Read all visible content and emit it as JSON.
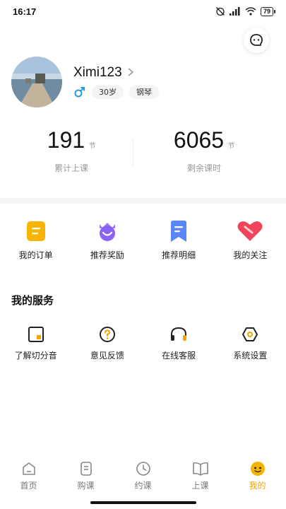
{
  "status_bar": {
    "time": "16:17",
    "battery": "79"
  },
  "profile": {
    "name": "Ximi123",
    "age": "30岁",
    "instrument": "钢琴"
  },
  "stats": [
    {
      "value": "191",
      "unit": "节",
      "label": "累计上课"
    },
    {
      "value": "6065",
      "unit": "节",
      "label": "剩余课时"
    }
  ],
  "quick_actions": [
    {
      "label": "我的订单",
      "icon": "order-icon"
    },
    {
      "label": "推荐奖励",
      "icon": "reward-icon"
    },
    {
      "label": "推荐明细",
      "icon": "bookmark-icon"
    },
    {
      "label": "我的关注",
      "icon": "heart-icon"
    }
  ],
  "services": {
    "title": "我的服务",
    "items": [
      {
        "label": "了解切分音",
        "icon": "about-icon"
      },
      {
        "label": "意见反馈",
        "icon": "feedback-icon"
      },
      {
        "label": "在线客服",
        "icon": "headset-icon"
      },
      {
        "label": "系统设置",
        "icon": "settings-icon"
      }
    ]
  },
  "tabs": [
    {
      "label": "首页",
      "icon": "home-icon"
    },
    {
      "label": "购课",
      "icon": "purchase-icon"
    },
    {
      "label": "约课",
      "icon": "clock-icon"
    },
    {
      "label": "上课",
      "icon": "book-icon"
    },
    {
      "label": "我的",
      "icon": "profile-face-icon",
      "active": true
    }
  ],
  "colors": {
    "accent": "#f5a300",
    "gender": "#1e9be8",
    "reward": "#8a63f5",
    "bookmark": "#5b86f5",
    "heart": "#f0445a"
  }
}
